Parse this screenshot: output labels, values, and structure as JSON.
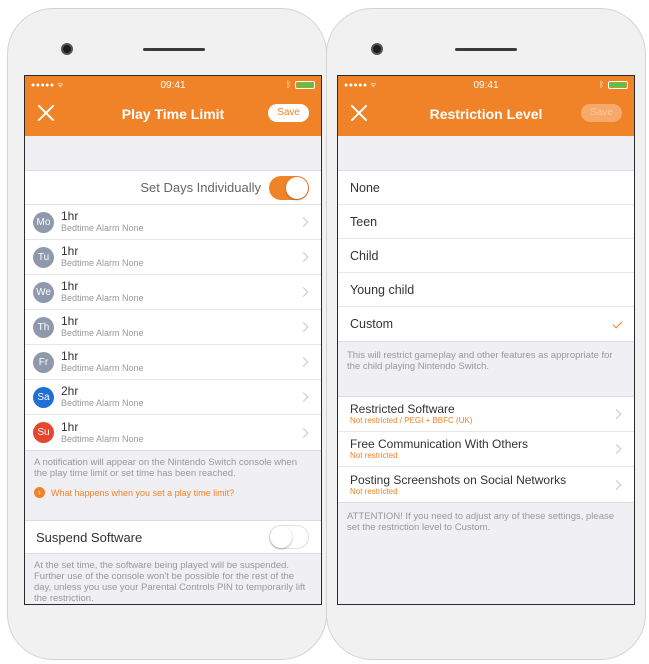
{
  "status_bar": {
    "signal": "●●●●● ᯤ",
    "time": "09:41",
    "bluetooth": "ᛒ"
  },
  "left_screen": {
    "title": "Play Time Limit",
    "save_label": "Save",
    "set_days_label": "Set Days Individually",
    "set_days_on": true,
    "days": [
      {
        "abbr": "Mo",
        "time": "1hr",
        "sub": "Bedtime Alarm None",
        "color": "#8e9aab"
      },
      {
        "abbr": "Tu",
        "time": "1hr",
        "sub": "Bedtime Alarm None",
        "color": "#8e9aab"
      },
      {
        "abbr": "We",
        "time": "1hr",
        "sub": "Bedtime Alarm None",
        "color": "#8e9aab"
      },
      {
        "abbr": "Th",
        "time": "1hr",
        "sub": "Bedtime Alarm None",
        "color": "#8e9aab"
      },
      {
        "abbr": "Fr",
        "time": "1hr",
        "sub": "Bedtime Alarm None",
        "color": "#8e9aab"
      },
      {
        "abbr": "Sa",
        "time": "2hr",
        "sub": "Bedtime Alarm None",
        "color": "#1f6fd6"
      },
      {
        "abbr": "Su",
        "time": "1hr",
        "sub": "Bedtime Alarm None",
        "color": "#e8452c"
      }
    ],
    "notification_text": "A notification will appear on the Nintendo Switch console when the play time limit or set time has been reached.",
    "help_link": "What happens when you set a play time limit?",
    "suspend_label": "Suspend Software",
    "suspend_on": false,
    "suspend_text": "At the set time, the software being played will be suspended. Further use of the console won't be possible for the rest of the day, unless you use your Parental Controls PIN to temporarily lift the restriction."
  },
  "right_screen": {
    "title": "Restriction Level",
    "save_label": "Save",
    "levels": [
      "None",
      "Teen",
      "Child",
      "Young child",
      "Custom"
    ],
    "selected_level": "Custom",
    "level_description": "This will restrict gameplay and other features as appropriate for the child playing Nintendo Switch.",
    "settings": [
      {
        "title": "Restricted Software",
        "value": "Not restricted / PEGI + BBFC (UK)"
      },
      {
        "title": "Free Communication With Others",
        "value": "Not restricted"
      },
      {
        "title": "Posting Screenshots on Social Networks",
        "value": "Not restricted"
      }
    ],
    "attention_text": "ATTENTION! If you need to adjust any of these settings, please set the restriction level to Custom."
  },
  "colors": {
    "accent": "#f08328",
    "background": "#efeff4"
  }
}
